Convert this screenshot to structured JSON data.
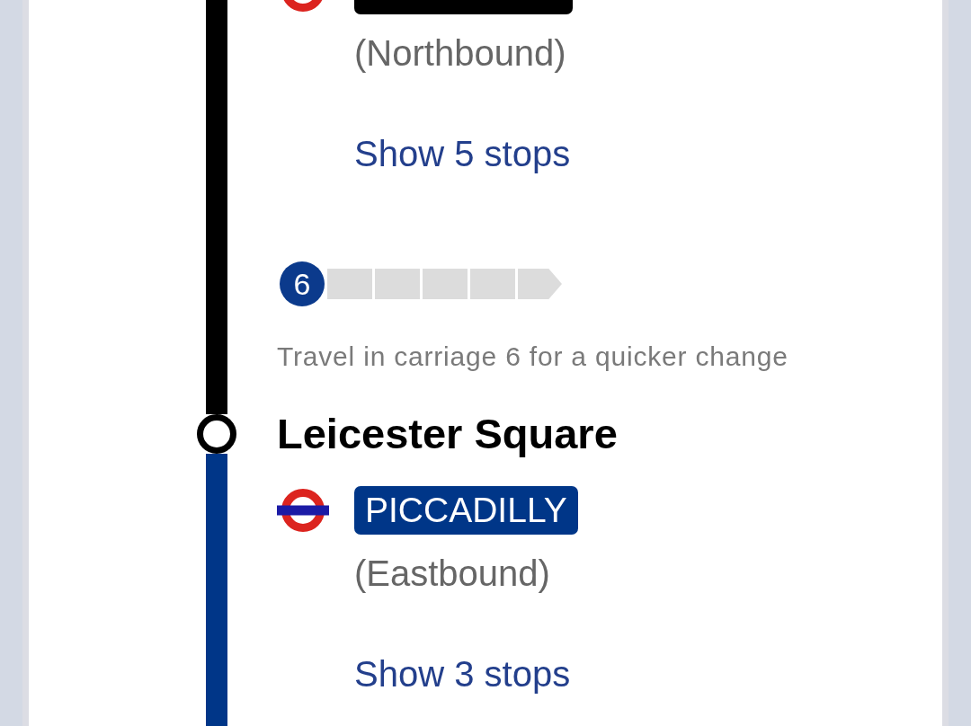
{
  "timeline": [
    {
      "kind": "leg",
      "color": "#000000",
      "direction": "(Northbound)",
      "stops_link": "Show 5 stops",
      "carriages": [
        {
          "label": "6",
          "selected": true
        },
        {
          "selected": false
        },
        {
          "selected": false
        },
        {
          "selected": false
        },
        {
          "selected": false
        },
        {
          "selected": false
        }
      ],
      "carriage_hint": "Travel in carriage 6 for a quicker change"
    },
    {
      "kind": "station",
      "name": "Leicester Square"
    },
    {
      "kind": "leg",
      "color": "#003688",
      "line": "PICCADILLY",
      "direction": "(Eastbound)",
      "stops_link": "Show 3 stops"
    }
  ]
}
